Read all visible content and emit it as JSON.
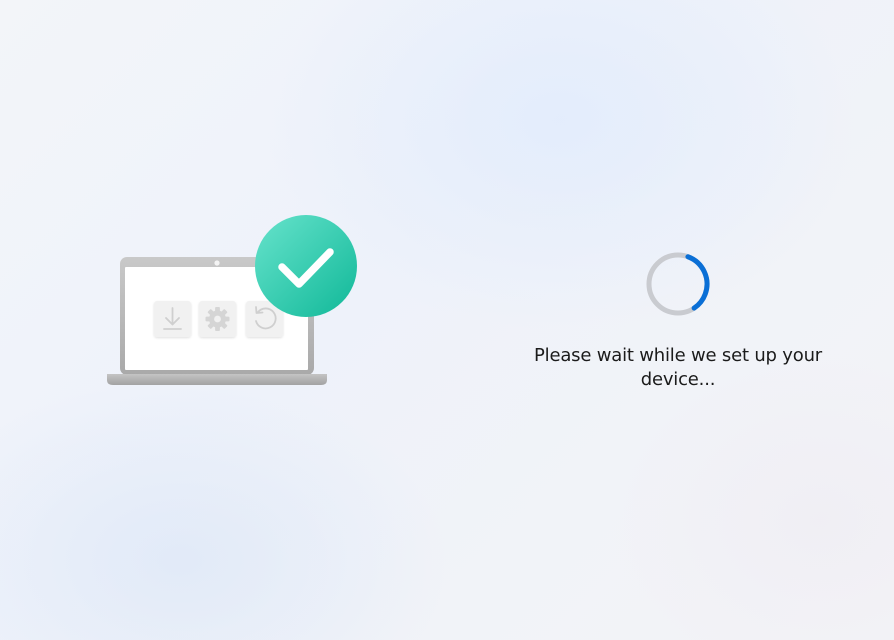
{
  "status": {
    "message": "Please wait while we set up your device..."
  },
  "illustration": {
    "icons": [
      "download-icon",
      "settings-gear-icon",
      "refresh-icon",
      "checkmark-icon"
    ],
    "badge_color": "#1dc9a6"
  },
  "spinner": {
    "accent_color": "#0a6fd6",
    "track_color": "#c9cbd0",
    "progress_fraction": 0.35
  }
}
